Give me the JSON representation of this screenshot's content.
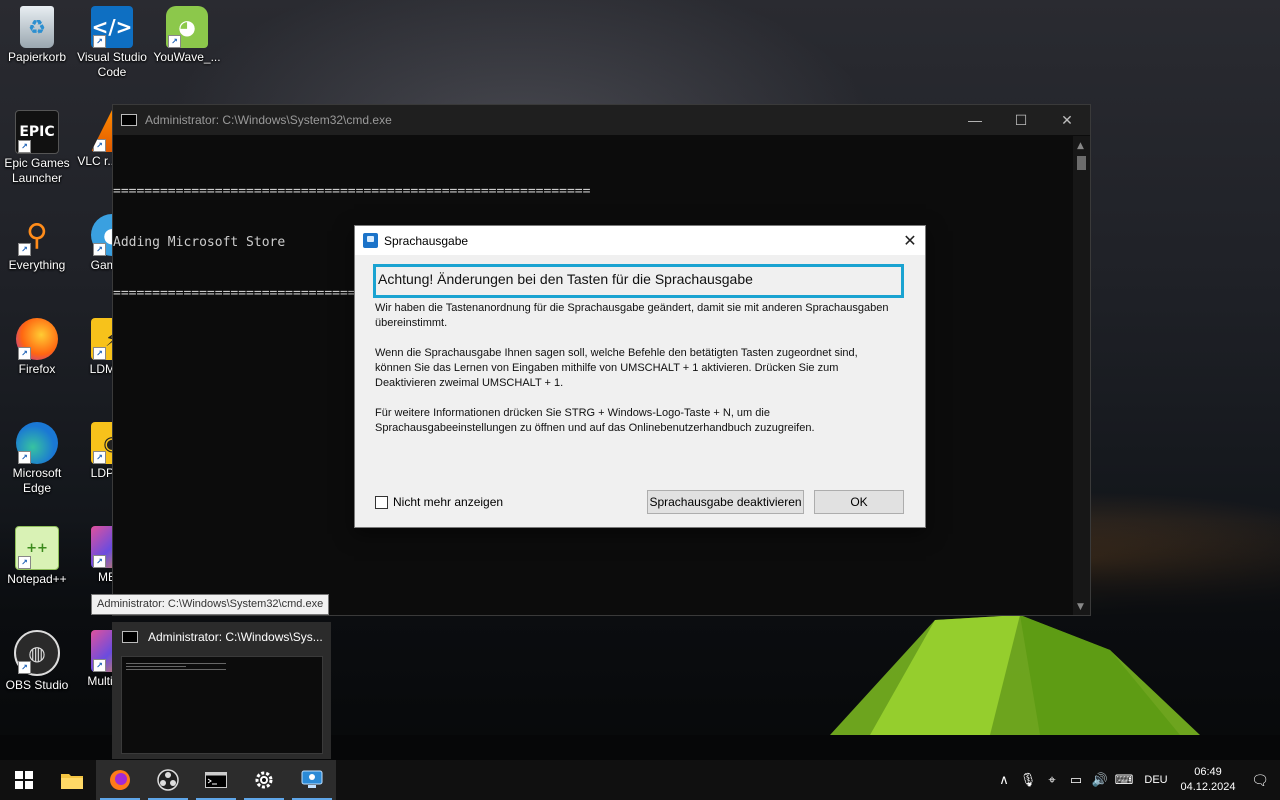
{
  "desktop": {
    "icons": [
      {
        "label": "Papierkorb",
        "icon": "recycle-bin-icon"
      },
      {
        "label": "Visual Studio Code",
        "icon": "vscode-icon"
      },
      {
        "label": "YouWave_...",
        "icon": "android-icon"
      },
      {
        "label": "Epic Games Launcher",
        "icon": "epic-games-icon"
      },
      {
        "label": "VLC r... pla...",
        "icon": "vlc-icon"
      },
      {
        "label": "Everything",
        "icon": "everything-search-icon"
      },
      {
        "label": "Game...",
        "icon": "game-icon"
      },
      {
        "label": "Firefox",
        "icon": "firefox-icon"
      },
      {
        "label": "LDMul...",
        "icon": "ldmultiplayer-icon"
      },
      {
        "label": "Microsoft Edge",
        "icon": "edge-icon"
      },
      {
        "label": "LDPla...",
        "icon": "ldplayer-icon"
      },
      {
        "label": "Notepad++",
        "icon": "notepadpp-icon"
      },
      {
        "label": "ME...",
        "icon": "me-icon"
      },
      {
        "label": "OBS Studio",
        "icon": "obs-icon"
      },
      {
        "label": "Multi-M...",
        "icon": "multi-m-icon"
      }
    ]
  },
  "cmd_window": {
    "title": "Administrator: C:\\Windows\\System32\\cmd.exe",
    "minimize": "—",
    "maximize": "☐",
    "close": "✕",
    "console_lines": [
      "=============================================================",
      "Adding Microsoft Store",
      "============================================================="
    ]
  },
  "dialog": {
    "title": "Sprachausgabe",
    "close": "✕",
    "heading": "Achtung! Änderungen bei den Tasten für die Sprachausgabe",
    "paragraphs": [
      "Wir haben die Tastenanordnung für die Sprachausgabe geändert, damit sie mit anderen Sprachausgaben übereinstimmt.",
      "Wenn die Sprachausgabe Ihnen sagen soll, welche Befehle den betätigten Tasten zugeordnet sind, können Sie das Lernen von Eingaben mithilfe von UMSCHALT + 1 aktivieren. Drücken Sie zum Deaktivieren zweimal UMSCHALT + 1.",
      "Für weitere Informationen drücken Sie STRG + Windows-Logo-Taste + N, um die Sprachausgabeeinstellungen zu öffnen und auf das Onlinebenutzerhandbuch zuzugreifen."
    ],
    "checkbox_label": "Nicht mehr anzeigen",
    "btn_deactivate": "Sprachausgabe deaktivieren",
    "btn_ok": "OK"
  },
  "tooltip": "Administrator: C:\\Windows\\System32\\cmd.exe",
  "preview": {
    "title": "Administrator: C:\\Windows\\Sys..."
  },
  "taskbar": {
    "items": [
      "start-icon",
      "file-explorer-icon",
      "firefox-icon",
      "obs-icon",
      "cmd-icon",
      "settings-icon",
      "narrator-icon"
    ],
    "tray": {
      "chevron": "∧",
      "language": "DEU",
      "time": "06:49",
      "date": "04.12.2024"
    }
  },
  "colors": {
    "accent": "#1aa3d1",
    "taskbar": "#101010",
    "cmd_bg": "#0c0c0c",
    "dialog_bg": "#f0f0f0"
  }
}
